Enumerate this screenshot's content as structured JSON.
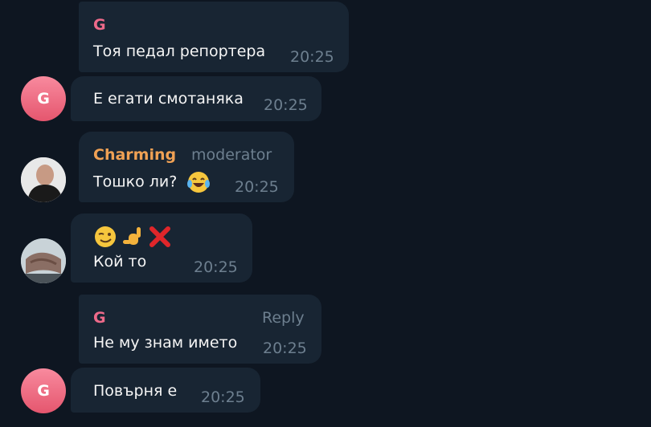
{
  "chat": {
    "messages": [
      {
        "sender": "G",
        "text": "Тоя педал репортера",
        "time": "20:25"
      },
      {
        "text": "Е егати смотаняка",
        "time": "20:25",
        "avatar_letter": "G"
      },
      {
        "sender": "Charming",
        "role": "moderator",
        "text": "Тошко ли?",
        "time": "20:25"
      },
      {
        "text": "Кой то",
        "time": "20:25"
      },
      {
        "sender": "G",
        "action": "Reply",
        "text": "Не му знам името",
        "time": "20:25"
      },
      {
        "text": "Повърня е",
        "time": "20:25",
        "avatar_letter": "G"
      }
    ],
    "colors": {
      "background": "#0e1621",
      "bubble": "#182533",
      "sender_g": "#ee6a8a",
      "sender_charming": "#f0a154",
      "meta_text": "#6d7f8f",
      "message_text": "#f5f5f5"
    },
    "icons": [
      "laughing-tears-emoji",
      "winking-face-emoji",
      "call-me-hand-emoji",
      "red-x-emoji"
    ]
  }
}
